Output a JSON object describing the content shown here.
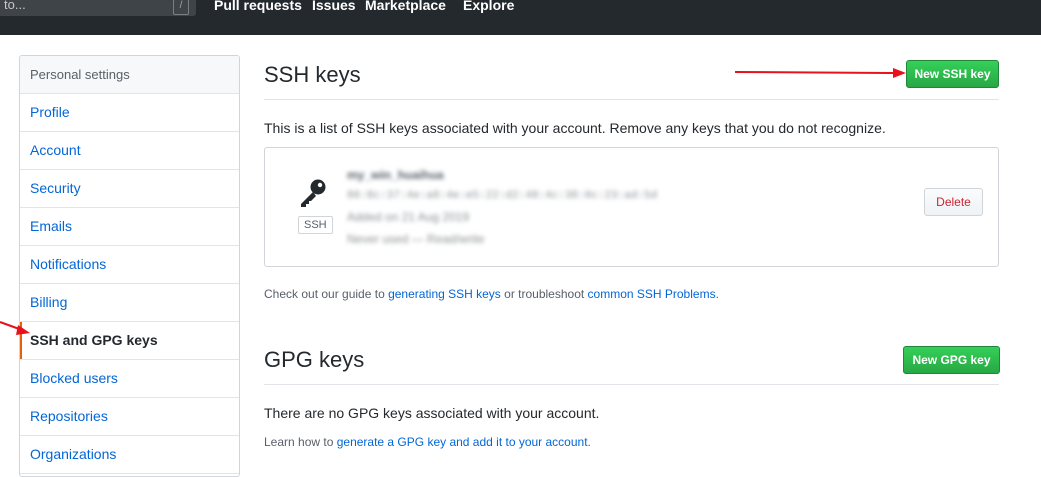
{
  "topbar": {
    "search_text": "to...",
    "slash_hint": "/",
    "nav": [
      "Pull requests",
      "Issues",
      "Marketplace",
      "Explore"
    ]
  },
  "sidebar": {
    "header": "Personal settings",
    "items": [
      {
        "label": "Profile"
      },
      {
        "label": "Account"
      },
      {
        "label": "Security"
      },
      {
        "label": "Emails"
      },
      {
        "label": "Notifications"
      },
      {
        "label": "Billing"
      },
      {
        "label": "SSH and GPG keys",
        "selected": true
      },
      {
        "label": "Blocked users"
      },
      {
        "label": "Repositories"
      },
      {
        "label": "Organizations"
      }
    ]
  },
  "ssh": {
    "title": "SSH keys",
    "new_button": "New SSH key",
    "description": "This is a list of SSH keys associated with your account. Remove any keys that you do not recognize.",
    "key": {
      "badge": "SSH",
      "title": "my_win_huaihua",
      "fingerprint": "86:8c:37:4e:a8:4e:e5:22:d2:48:4c:38:0c:23:ad:5d",
      "added": "Added on 21 Aug 2019",
      "usage": "Never used — Read/write",
      "delete_button": "Delete"
    },
    "guide_prefix": "Check out our guide to ",
    "guide_link1": "generating SSH keys",
    "guide_middle": " or troubleshoot ",
    "guide_link2": "common SSH Problems",
    "guide_suffix": "."
  },
  "gpg": {
    "title": "GPG keys",
    "new_button": "New GPG key",
    "empty_text": "There are no GPG keys associated with your account.",
    "learn_prefix": "Learn how to ",
    "learn_link": "generate a GPG key and add it to your account",
    "learn_suffix": "."
  },
  "colors": {
    "annotation_arrow": "#e8121b",
    "green_button": "#28a745",
    "link": "#0366d6",
    "selected_marker": "#e36209"
  }
}
